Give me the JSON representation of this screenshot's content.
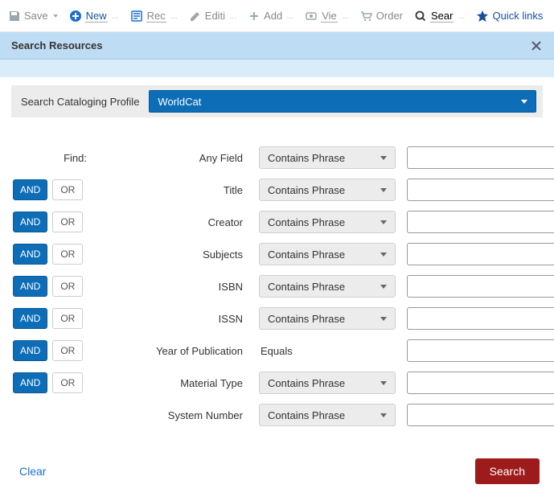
{
  "toolbar": {
    "save": "Save",
    "new": "New",
    "record": "Rec",
    "editing": "Editi",
    "add": "Add",
    "view": "Vie",
    "order": "Order",
    "search": "Sear",
    "quick_links": "Quick links"
  },
  "panel": {
    "title": "Search Resources"
  },
  "profile": {
    "label": "Search Cataloging Profile",
    "value": "WorldCat"
  },
  "operators": {
    "and": "AND",
    "or": "OR"
  },
  "find_label": "Find:",
  "rows": [
    {
      "field": "Any Field",
      "condition": "Contains Phrase",
      "has_op": false,
      "cond_type": "select"
    },
    {
      "field": "Title",
      "condition": "Contains Phrase",
      "has_op": true,
      "cond_type": "select"
    },
    {
      "field": "Creator",
      "condition": "Contains Phrase",
      "has_op": true,
      "cond_type": "select"
    },
    {
      "field": "Subjects",
      "condition": "Contains Phrase",
      "has_op": true,
      "cond_type": "select"
    },
    {
      "field": "ISBN",
      "condition": "Contains Phrase",
      "has_op": true,
      "cond_type": "select"
    },
    {
      "field": "ISSN",
      "condition": "Contains Phrase",
      "has_op": true,
      "cond_type": "select"
    },
    {
      "field": "Year of Publication",
      "condition": "Equals",
      "has_op": true,
      "cond_type": "static"
    },
    {
      "field": "Material Type",
      "condition": "Contains Phrase",
      "has_op": true,
      "cond_type": "select"
    },
    {
      "field": "System Number",
      "condition": "Contains Phrase",
      "has_op": false,
      "cond_type": "select"
    }
  ],
  "footer": {
    "clear": "Clear",
    "search": "Search"
  }
}
